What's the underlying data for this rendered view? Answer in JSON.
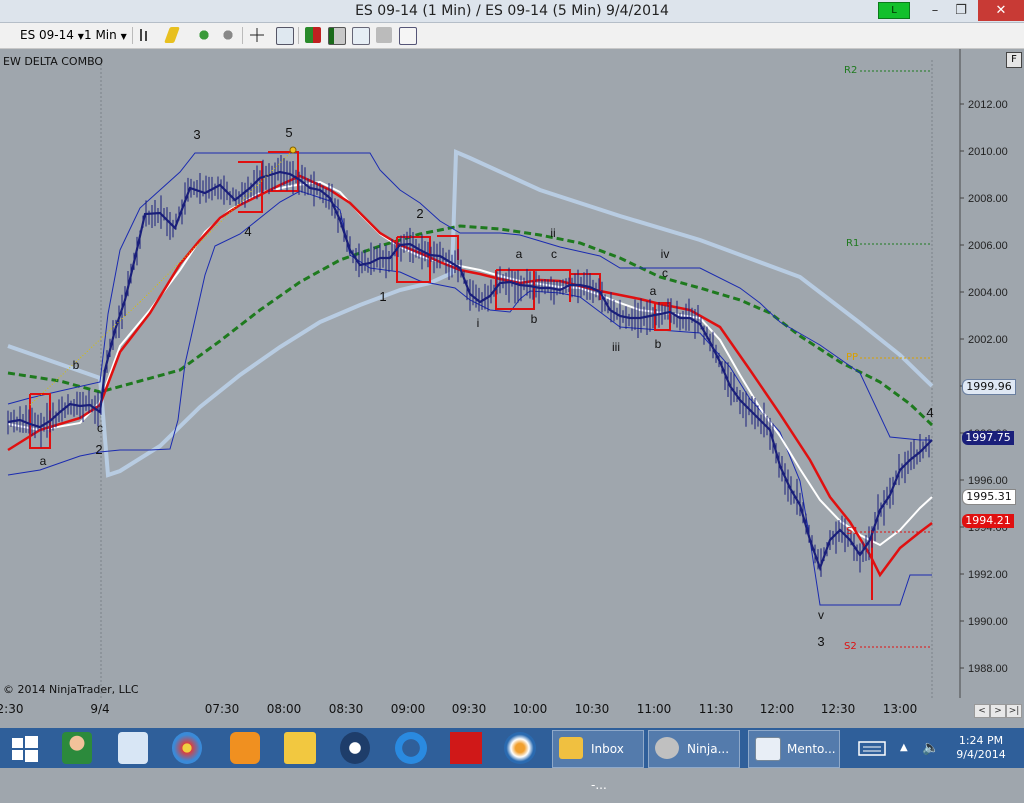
{
  "window": {
    "title": "ES 09-14 (1 Min) / ES 09-14 (5 Min)  9/4/2014",
    "connection_indicator": "L",
    "minimize": "–",
    "restore": "❐",
    "close": "✕"
  },
  "toolbar": {
    "instrument": "ES 09-14",
    "interval": "1 Min"
  },
  "chart": {
    "indicator_label": "EW DELTA COMBO",
    "copyright": "© 2014 NinjaTrader, LLC",
    "f_button": "F",
    "price_axis": [
      "2012.00",
      "2010.00",
      "2008.00",
      "2006.00",
      "2004.00",
      "2002.00",
      "2000.00",
      "1998.00",
      "1996.00",
      "1994.00",
      "1992.00",
      "1990.00",
      "1988.00"
    ],
    "time_axis": [
      "2:30",
      "9/4",
      "07:30",
      "08:00",
      "08:30",
      "09:00",
      "09:30",
      "10:00",
      "10:30",
      "11:00",
      "11:30",
      "12:00",
      "12:30",
      "13:00"
    ],
    "price_flags": {
      "blue_line": "1999.96",
      "last_price": "1997.75",
      "white_line": "1995.31",
      "red_line": "1994.21"
    },
    "pivots": {
      "r2": "R2",
      "r1": "R1",
      "pp": "PP",
      "s1": "S1",
      "s2": "S2"
    },
    "wave_labels": [
      "3",
      "5",
      "4",
      "2",
      "1",
      "i",
      "a",
      "b",
      "c",
      "ii",
      "iii",
      "a",
      "b",
      "c",
      "iv",
      "v",
      "3",
      "4",
      "a",
      "b",
      "c",
      "2"
    ],
    "scroll_left": "<",
    "scroll_right": ">",
    "scroll_end": ">|",
    "chart_colors": {
      "background": "#9fa6ad",
      "price": "#1a1f7a",
      "red_line": "#e01010",
      "white_line": "#ffffff",
      "green_dash": "#1e7a1e",
      "light_blue": "#b4c8e0",
      "channel": "#1b2bb0"
    }
  },
  "taskbar": {
    "apps": [
      {
        "label": "Inbox -..."
      },
      {
        "label": "Ninja..."
      },
      {
        "label": "Mento..."
      }
    ],
    "time": "1:24 PM",
    "date": "9/4/2014"
  }
}
